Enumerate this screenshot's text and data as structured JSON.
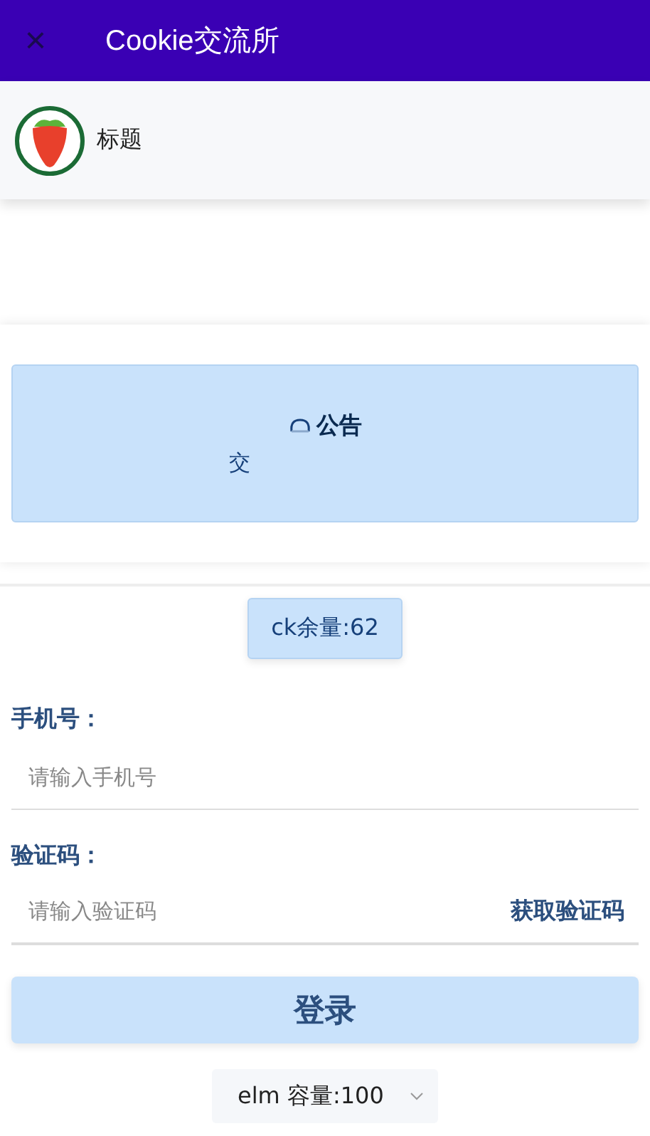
{
  "app_bar": {
    "close_icon": "×",
    "title": "Cookie交流所"
  },
  "nav_bar": {
    "title": "标题"
  },
  "notice": {
    "title": "公告",
    "body": "交"
  },
  "badge": "ck余量:62",
  "form": {
    "fields": [
      {
        "label": "手机号：",
        "placeholder": "请输入手机号"
      },
      {
        "label": "验证码：",
        "placeholder": "请输入验证码",
        "action": "获取验证码"
      }
    ],
    "submit": "登录",
    "select": {
      "value": "elm 容量:100"
    }
  }
}
